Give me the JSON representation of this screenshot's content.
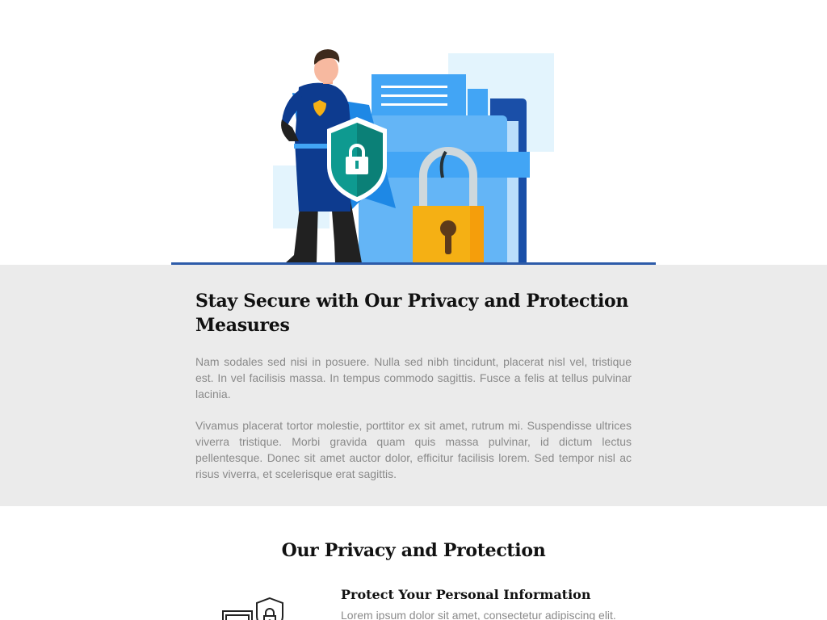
{
  "hero": {
    "illustration": "security-hero-with-shield-padlock-and-folder",
    "colors": {
      "accent_line": "#2d5ba9",
      "folder_blue": "#64b5f6",
      "shield_teal": "#0e9a90",
      "padlock_gold": "#f5b014"
    }
  },
  "intro": {
    "title": "Stay Secure with Our Privacy and Protection Measures",
    "paragraph1": "Nam sodales sed nisi in posuere. Nulla sed nibh tincidunt, placerat nisl vel, tristique est. In vel facilisis massa. In tempus commodo sagittis. Fusce a felis at tellus pulvinar lacinia.",
    "paragraph2": "Vivamus placerat tortor molestie, porttitor ex sit amet, rutrum mi. Suspendisse ultrices viverra tristique. Morbi gravida quam quis massa pulvinar, id dictum lectus pellentesque. Donec sit amet auctor dolor, efficitur facilisis lorem. Sed tempor nisl ac risus viverra, et scelerisque erat sagittis."
  },
  "section2": {
    "title": "Our Privacy and Protection",
    "features": [
      {
        "icon": "shield-lock-card-icon",
        "title": "Protect Your Personal Information",
        "text": "Lorem ipsum dolor sit amet, consectetur adipiscing elit."
      }
    ]
  }
}
